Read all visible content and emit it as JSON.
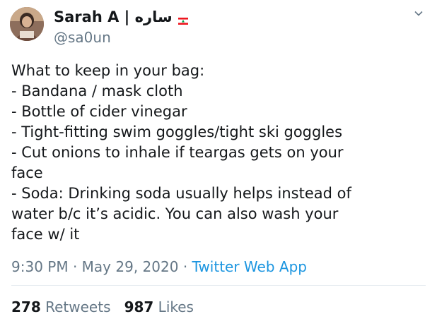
{
  "tweet": {
    "author": {
      "display_name": "Sarah A | ساره",
      "flag_icon": "lebanon-flag-icon",
      "handle": "@sa0un"
    },
    "caret_icon": "chevron-down-icon",
    "body_lines": [
      "What to keep in your bag:",
      "- Bandana / mask cloth",
      "- Bottle of cider vinegar",
      "- Tight-fitting swim goggles/tight ski goggles",
      "- Cut onions to inhale if teargas gets on your",
      "face",
      "- Soda: Drinking soda usually helps instead of",
      "water b/c it’s acidic. You can also wash your",
      "face w/ it"
    ],
    "meta": {
      "time": "9:30 PM",
      "separator": "·",
      "date": "May 29, 2020",
      "source": "Twitter Web App"
    },
    "stats": {
      "retweets_count": "278",
      "retweets_label": "Retweets",
      "likes_count": "987",
      "likes_label": "Likes"
    }
  },
  "colors": {
    "text_primary": "#14171a",
    "text_secondary": "#657786",
    "link": "#1b95e0",
    "divider": "#e6ecf0",
    "flag_red": "#ee161f",
    "flag_green": "#00a651"
  }
}
